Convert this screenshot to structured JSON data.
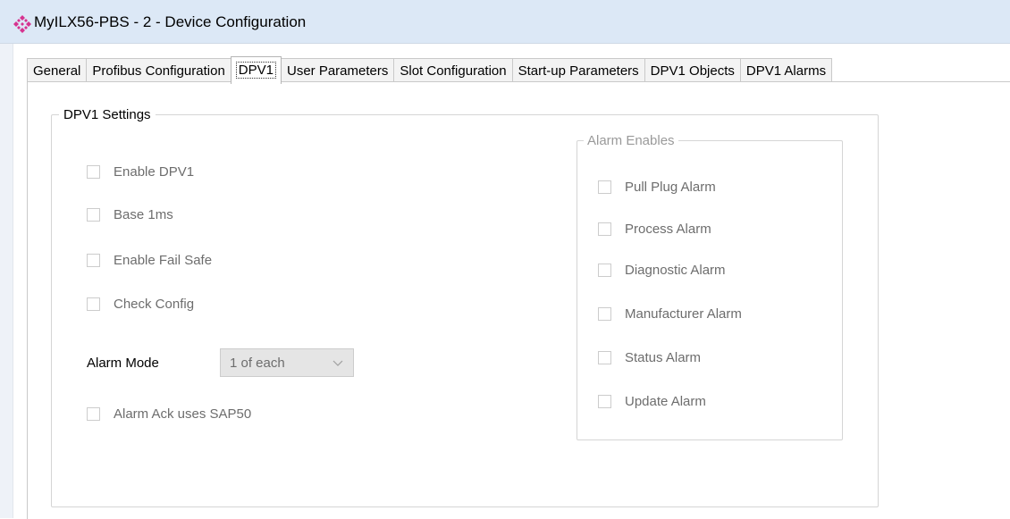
{
  "window": {
    "title": "MyILX56-PBS - 2 - Device Configuration",
    "icon": "device-diamonds-icon"
  },
  "tabs": [
    {
      "label": "General",
      "active": false
    },
    {
      "label": "Profibus Configuration",
      "active": false
    },
    {
      "label": "DPV1",
      "active": true
    },
    {
      "label": "User Parameters",
      "active": false
    },
    {
      "label": "Slot Configuration",
      "active": false
    },
    {
      "label": "Start-up Parameters",
      "active": false
    },
    {
      "label": "DPV1 Objects",
      "active": false
    },
    {
      "label": "DPV1 Alarms",
      "active": false
    }
  ],
  "dpv1_settings": {
    "legend": "DPV1 Settings",
    "enable_dpv1": {
      "label": "Enable DPV1",
      "checked": false
    },
    "base_1ms": {
      "label": "Base 1ms",
      "checked": false
    },
    "enable_fail_safe": {
      "label": "Enable Fail Safe",
      "checked": false
    },
    "check_config": {
      "label": "Check Config",
      "checked": false
    },
    "alarm_mode": {
      "label": "Alarm Mode",
      "value": "1 of each"
    },
    "alarm_ack_sap50": {
      "label": "Alarm Ack uses SAP50",
      "checked": false
    }
  },
  "alarm_enables": {
    "legend": "Alarm Enables",
    "pull_plug": {
      "label": "Pull Plug Alarm",
      "checked": false
    },
    "process": {
      "label": "Process Alarm",
      "checked": false
    },
    "diagnostic": {
      "label": "Diagnostic Alarm",
      "checked": false
    },
    "manufacturer": {
      "label": "Manufacturer Alarm",
      "checked": false
    },
    "status": {
      "label": "Status Alarm",
      "checked": false
    },
    "update": {
      "label": "Update Alarm",
      "checked": false
    }
  },
  "colors": {
    "titlebar": "#dce8f6",
    "icon_accent": "#d6338f",
    "disabled_text": "#6d6d6d"
  }
}
